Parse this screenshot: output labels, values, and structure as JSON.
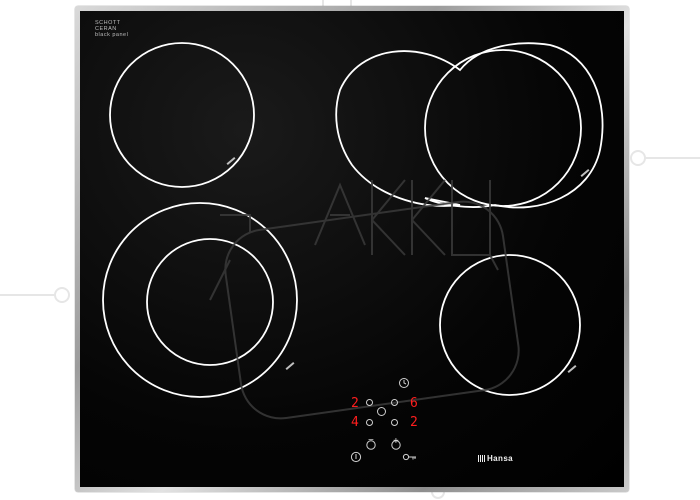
{
  "manufacturer_label": {
    "line1": "SCHOTT",
    "line2": "CERAN",
    "line3": "black panel"
  },
  "brand": "Hansa",
  "controls": {
    "left_top_digit": "2",
    "right_top_digit": "6",
    "left_bottom_digit": "4",
    "right_bottom_digit": "2",
    "minus_symbol": "−",
    "plus_symbol": "+",
    "timer_icon": "clock-icon",
    "power_icon": "power-icon",
    "lock_icon": "key-lock-icon"
  },
  "watermark": "ККЦ",
  "colors": {
    "glass": "#000000",
    "frame": "#b0b0b0",
    "display_red": "#ff1e1e",
    "zone_lines": "#ffffff"
  }
}
